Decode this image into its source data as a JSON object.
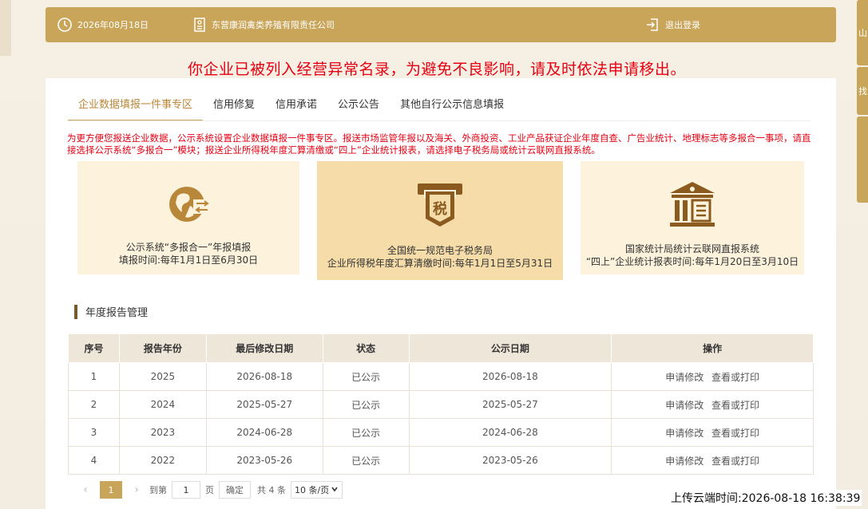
{
  "header": {
    "date": "2026年08月18日",
    "company": "东营康润禽类养殖有限责任公司",
    "logout": "退出登录"
  },
  "side_tabs": [
    "山",
    "找",
    ""
  ],
  "warning": "你企业已被列入经营异常名录，为避免不良影响，请及时依法申请移出。",
  "tabs": [
    {
      "label": "企业数据填报一件事专区",
      "active": true
    },
    {
      "label": "信用修复"
    },
    {
      "label": "信用承诺"
    },
    {
      "label": "公示公告"
    },
    {
      "label": "其他自行公示信息填报"
    }
  ],
  "notice": "为更方便您报送企业数据，公示系统设置企业数据填报一件事专区。报送市场监管年报以及海关、外商投资、工业产品获证企业年度自查、广告业统计、地理标志等多报合一事项，请直接选择公示系统“多报合一”模块；报送企业所得税年度汇算清缴或“四上”企业统计报表，请选择电子税务局或统计云联网直报系统。",
  "cards": [
    {
      "line1": "公示系统“多报合一”年报填报",
      "line2": "填报时间:每年1月1日至6月30日",
      "icon": "globe-arrows-icon"
    },
    {
      "line1": "全国统一规范电子税务局",
      "line2": "企业所得税年度汇算清缴时间:每年1月1日至5月31日",
      "icon": "tax-icon"
    },
    {
      "line1": "国家统计局统计云联网直报系统",
      "line2": "“四上”企业统计报表时间:每年1月20日至3月10日",
      "icon": "building-icon"
    }
  ],
  "section_title": "年度报告管理",
  "table": {
    "headers": [
      "序号",
      "报告年份",
      "最后修改日期",
      "状态",
      "公示日期",
      "操作"
    ],
    "rows": [
      {
        "no": "1",
        "year": "2025",
        "modified": "2026-08-18",
        "status": "已公示",
        "published": "2026-08-18"
      },
      {
        "no": "2",
        "year": "2024",
        "modified": "2025-05-27",
        "status": "已公示",
        "published": "2025-05-27"
      },
      {
        "no": "3",
        "year": "2023",
        "modified": "2024-06-28",
        "status": "已公示",
        "published": "2024-06-28"
      },
      {
        "no": "4",
        "year": "2022",
        "modified": "2023-05-26",
        "status": "已公示",
        "published": "2023-05-26"
      }
    ],
    "op_modify": "申请修改",
    "op_view": "查看或打印"
  },
  "pager": {
    "current": "1",
    "goto_label": "到第",
    "goto_value": "1",
    "page_unit": "页",
    "confirm": "确定",
    "total": "共 4 条",
    "page_size": "10 条/页"
  },
  "upload_time": "上传云端时间:2026-08-18 16:38:39",
  "colors": {
    "gold": "#c9a55a",
    "warning_red": "#e60012",
    "card_bg": "#fdf3dc",
    "card_active_bg": "#f5dca8"
  }
}
